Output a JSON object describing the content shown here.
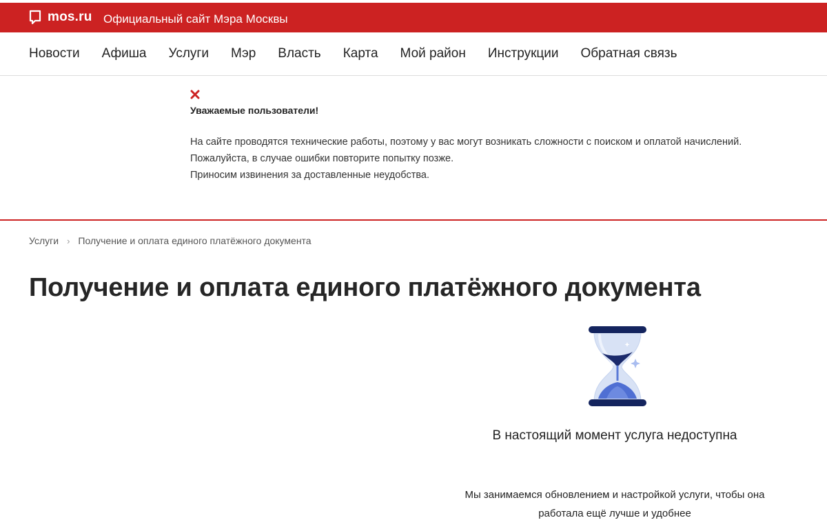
{
  "header": {
    "logo_text": "mos.ru",
    "site_title": "Официальный сайт Мэра Москвы",
    "brand_color": "#cc2222"
  },
  "nav": {
    "items": [
      {
        "label": "Новости"
      },
      {
        "label": "Афиша"
      },
      {
        "label": "Услуги"
      },
      {
        "label": "Мэр"
      },
      {
        "label": "Власть"
      },
      {
        "label": "Карта"
      },
      {
        "label": "Мой район"
      },
      {
        "label": "Инструкции"
      },
      {
        "label": "Обратная связь"
      }
    ]
  },
  "notice": {
    "close_icon": "close-icon",
    "title": "Уважаемые пользователи!",
    "lines": [
      "На сайте проводятся технические работы, поэтому у вас могут возникать сложности с поиском и оплатой начислений.",
      "Пожалуйста, в случае ошибки повторите попытку позже.",
      "Приносим извинения за доставленные неудобства."
    ]
  },
  "breadcrumb": {
    "items": [
      {
        "label": "Услуги"
      },
      {
        "label": "Получение и оплата единого платёжного документа"
      }
    ],
    "separator": "›"
  },
  "page": {
    "title": "Получение и оплата единого платёжного документа"
  },
  "status": {
    "icon": "hourglass-icon",
    "title": "В настоящий момент услуга недоступна",
    "description": "Мы занимаемся обновлением и настройкой услуги, чтобы она работала ещё лучше и удобнее"
  }
}
